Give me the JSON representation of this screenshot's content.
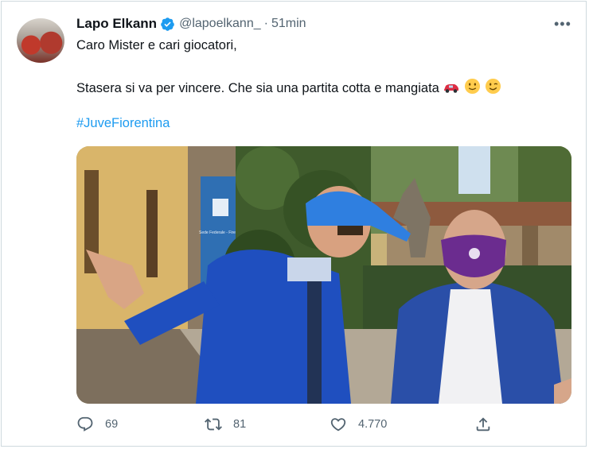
{
  "tweet": {
    "author_name": "Lapo Elkann",
    "handle": "@lapoelkann_",
    "separator": "·",
    "time": "51min",
    "more_label": "•••",
    "line1": "Caro Mister e cari giocatori,",
    "line2": "Stasera si va per vincere. Che sia una partita cotta e mangiata",
    "hashtag": "#JuveFiorentina",
    "emojis": [
      "car-icon",
      "slightly-smiling-face-icon",
      "winking-face-icon"
    ],
    "photo": {
      "sign_text": "Sede Federale - Firenze"
    }
  },
  "actions": {
    "replies": "69",
    "retweets": "81",
    "likes": "4.770"
  },
  "colors": {
    "link": "#1d9bf0",
    "secondary": "#536471",
    "verified": "#1d9bf0"
  }
}
